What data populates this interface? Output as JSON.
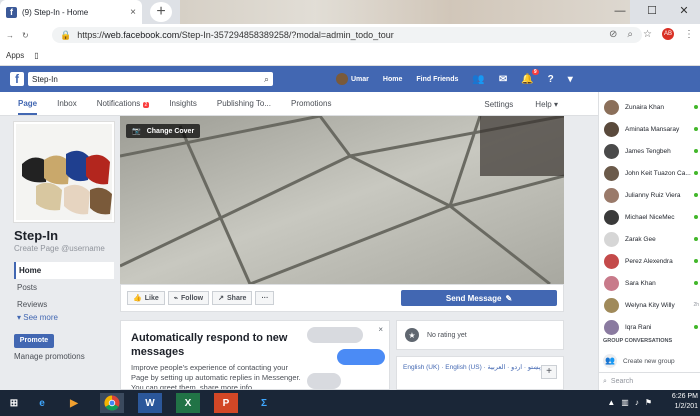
{
  "browser": {
    "tab_title": "(9) Step-In - Home",
    "tab_close": "×",
    "new_tab": "+",
    "window_controls": [
      "—",
      "☐",
      "✕"
    ],
    "url_scheme": "https://",
    "url_host": "web.facebook.com",
    "url_path": "/Step-In-357294858389258/?modal=admin_todo_tour",
    "bookmarks_apps": "Apps",
    "profile_initial": "AB"
  },
  "fb": {
    "logo": "f",
    "search_value": "Step-In",
    "user_name": "Umar",
    "nav_home": "Home",
    "nav_find_friends": "Find Friends",
    "notif_count": "9"
  },
  "page_tabs": {
    "page": "Page",
    "inbox": "Inbox",
    "notifications": "Notifications",
    "notifications_badge": "2",
    "insights": "Insights",
    "publishing_tools": "Publishing To...",
    "promotions": "Promotions",
    "settings": "Settings",
    "help": "Help"
  },
  "left": {
    "page_name": "Step-In",
    "create_username": "Create Page @username",
    "nav": [
      "Home",
      "Posts",
      "Reviews"
    ],
    "see_more": "See more",
    "promote": "Promote",
    "manage_promotions": "Manage promotions"
  },
  "cover": {
    "change_cover": "Change Cover"
  },
  "actions": {
    "like": "Like",
    "follow": "Follow",
    "share": "Share",
    "more": "···",
    "send_message": "Send Message"
  },
  "auto_respond": {
    "title": "Automatically respond to new messages",
    "body": "Improve people's experience of contacting your Page by setting up automatic replies in Messenger. You can greet them, share more info",
    "close": "×"
  },
  "rating": {
    "text": "No rating yet"
  },
  "languages": {
    "text": "English (UK) · English (US) · پښتو · اردو · العربية",
    "plus": "+"
  },
  "chat": {
    "contacts": [
      {
        "name": "Zunaira Khan",
        "color": "#8b6f5a",
        "online": true
      },
      {
        "name": "Aminata Mansaray",
        "color": "#5a4a3c",
        "online": true
      },
      {
        "name": "James Tengbeh",
        "color": "#4a4a4a",
        "online": true
      },
      {
        "name": "John Keit Tuazon Ca...",
        "color": "#6b5a4a",
        "online": true
      },
      {
        "name": "Julianny Ruiz Viera",
        "color": "#9a7a6a",
        "online": true
      },
      {
        "name": "Michael NiceMec",
        "color": "#3a3a3a",
        "online": true
      },
      {
        "name": "Zarak Gee",
        "color": "#d6d6d6",
        "online": true
      },
      {
        "name": "Perez Alexendra",
        "color": "#c44a4a",
        "online": true
      },
      {
        "name": "Sara Khan",
        "color": "#c87a8a",
        "online": true
      },
      {
        "name": "Welyna Kity Willy",
        "color": "#a08a5a",
        "online": false,
        "idle": "2h"
      },
      {
        "name": "Iqra Rani",
        "color": "#8a7aa0",
        "online": true
      }
    ],
    "group_conversations": "GROUP CONVERSATIONS",
    "create_group": "Create new group",
    "search": "Search"
  },
  "taskbar": {
    "time": "6:26 PM",
    "date": "1/2/201"
  },
  "colors": {
    "fb_blue": "#4267b2",
    "page_bg": "#e9ebee",
    "taskbar": "#1a2637"
  }
}
